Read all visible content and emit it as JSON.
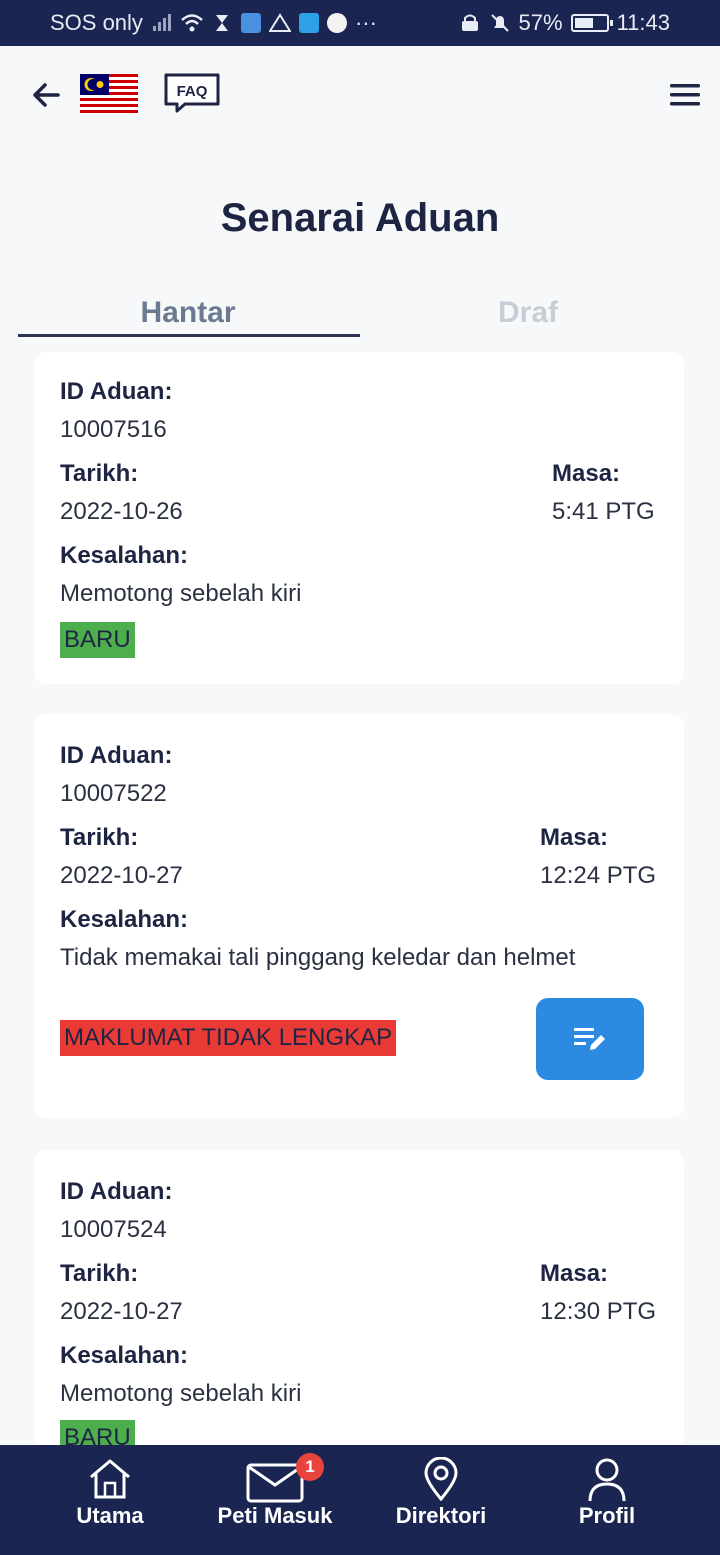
{
  "status_bar": {
    "carrier": "SOS only",
    "battery": "57%",
    "time": "11:43"
  },
  "header": {
    "faq_label": "FAQ"
  },
  "page": {
    "title": "Senarai Aduan"
  },
  "tabs": [
    {
      "label": "Hantar",
      "active": true
    },
    {
      "label": "Draf",
      "active": false
    }
  ],
  "labels": {
    "id": "ID Aduan:",
    "date": "Tarikh:",
    "time": "Masa:",
    "offense": "Kesalahan:"
  },
  "complaints": [
    {
      "id": "10007516",
      "date": "2022-10-26",
      "time": "5:41 PTG",
      "offense": "Memotong sebelah kiri",
      "status": "BARU"
    },
    {
      "id": "10007522",
      "date": "2022-10-27",
      "time": "12:24 PTG",
      "offense": "Tidak memakai tali pinggang keledar dan helmet",
      "status": "MAKLUMAT TIDAK LENGKAP"
    },
    {
      "id": "10007524",
      "date": "2022-10-27",
      "time": "12:30 PTG",
      "offense": "Memotong sebelah kiri",
      "status": "BARU"
    }
  ],
  "bottom_nav": [
    {
      "label": "Utama",
      "icon": "home-icon"
    },
    {
      "label": "Peti Masuk",
      "icon": "mail-icon",
      "badge": "1"
    },
    {
      "label": "Direktori",
      "icon": "location-pin-icon"
    },
    {
      "label": "Profil",
      "icon": "user-icon"
    }
  ],
  "colors": {
    "navy": "#1b2552",
    "status_new": "#4cae4c",
    "status_incomplete": "#ea3a35",
    "edit_button": "#2c8be0"
  }
}
